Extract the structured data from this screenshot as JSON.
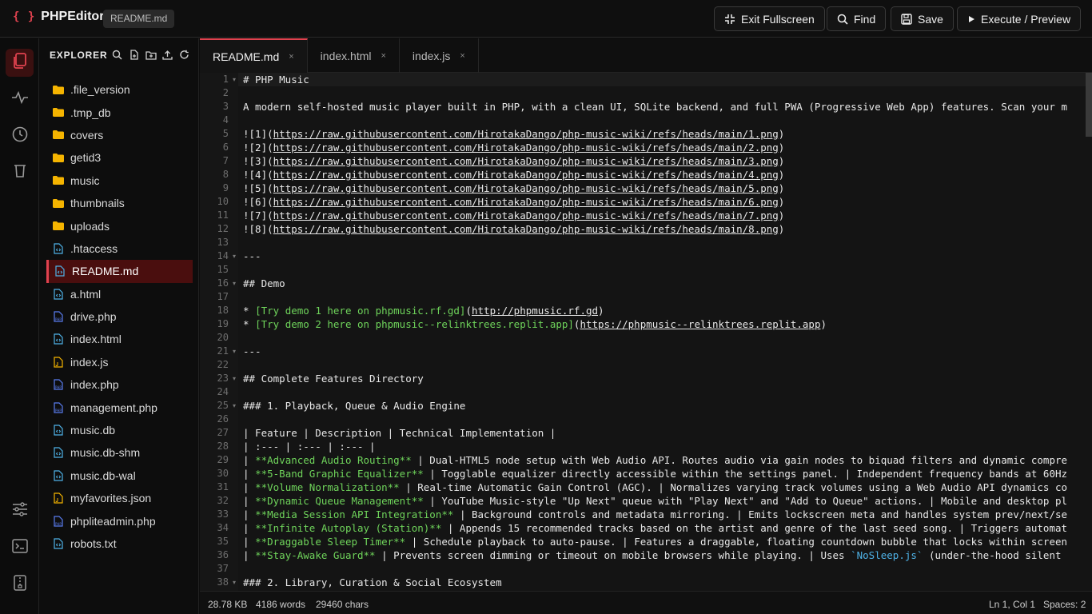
{
  "app": {
    "brand_icon": "{ }",
    "name": "PHPEditor",
    "file_badge": "README.md",
    "accent": "#e0424f"
  },
  "toolbar": {
    "exit_fullscreen": "Exit Fullscreen",
    "find": "Find",
    "save": "Save",
    "execute": "Execute / Preview"
  },
  "explorer": {
    "title": "EXPLORER",
    "items": [
      {
        "label": ".file_version",
        "type": "folder"
      },
      {
        "label": ".tmp_db",
        "type": "folder"
      },
      {
        "label": "covers",
        "type": "folder"
      },
      {
        "label": "getid3",
        "type": "folder"
      },
      {
        "label": "music",
        "type": "folder"
      },
      {
        "label": "thumbnails",
        "type": "folder"
      },
      {
        "label": "uploads",
        "type": "folder"
      },
      {
        "label": ".htaccess",
        "type": "file"
      },
      {
        "label": "README.md",
        "type": "file"
      },
      {
        "label": "a.html",
        "type": "file"
      },
      {
        "label": "drive.php",
        "type": "php"
      },
      {
        "label": "index.html",
        "type": "file"
      },
      {
        "label": "index.js",
        "type": "js"
      },
      {
        "label": "index.php",
        "type": "php"
      },
      {
        "label": "management.php",
        "type": "php"
      },
      {
        "label": "music.db",
        "type": "file"
      },
      {
        "label": "music.db-shm",
        "type": "file"
      },
      {
        "label": "music.db-wal",
        "type": "file"
      },
      {
        "label": "myfavorites.json",
        "type": "js"
      },
      {
        "label": "phpliteadmin.php",
        "type": "php"
      },
      {
        "label": "robots.txt",
        "type": "file"
      }
    ]
  },
  "tabs": [
    {
      "label": "README.md",
      "close": "×"
    },
    {
      "label": "index.html",
      "close": "×"
    },
    {
      "label": "index.js",
      "close": "×"
    }
  ],
  "editor": {
    "line_numbers": [
      "1",
      "2",
      "3",
      "4",
      "5",
      "6",
      "7",
      "8",
      "9",
      "10",
      "11",
      "12",
      "13",
      "14",
      "15",
      "16",
      "17",
      "18",
      "19",
      "20",
      "21",
      "22",
      "23",
      "24",
      "25",
      "26",
      "27",
      "28",
      "29",
      "30",
      "31",
      "32",
      "33",
      "34",
      "35",
      "36",
      "37",
      "38"
    ],
    "lines": {
      "l1": "# PHP Music",
      "l3": "A modern self-hosted music player built in PHP, with a clean UI, SQLite backend, and full PWA (Progressive Web App) features. Scan your m",
      "img_prefix": [
        "![1](",
        "![2](",
        "![3](",
        "![4](",
        "![5](",
        "![6](",
        "![7](",
        "![8]("
      ],
      "img_urls": [
        "https://raw.githubusercontent.com/HirotakaDango/php-music-wiki/refs/heads/main/1.png",
        "https://raw.githubusercontent.com/HirotakaDango/php-music-wiki/refs/heads/main/2.png",
        "https://raw.githubusercontent.com/HirotakaDango/php-music-wiki/refs/heads/main/3.png",
        "https://raw.githubusercontent.com/HirotakaDango/php-music-wiki/refs/heads/main/4.png",
        "https://raw.githubusercontent.com/HirotakaDango/php-music-wiki/refs/heads/main/5.png",
        "https://raw.githubusercontent.com/HirotakaDango/php-music-wiki/refs/heads/main/6.png",
        "https://raw.githubusercontent.com/HirotakaDango/php-music-wiki/refs/heads/main/7.png",
        "https://raw.githubusercontent.com/HirotakaDango/php-music-wiki/refs/heads/main/8.png"
      ],
      "close_paren": ")",
      "hr": "---",
      "l16": "## Demo",
      "l18_a": "* ",
      "l18_b": "[Try demo 1 here on phpmusic.rf.gd]",
      "l18_c": "(",
      "l18_d": "http://phpmusic.rf.gd",
      "l19_b": "[Try demo 2 here on phpmusic--relinktrees.replit.app]",
      "l19_d": "https://phpmusic--relinktrees.replit.app",
      "l23": "## Complete Features Directory",
      "l25": "### 1. Playback, Queue & Audio Engine",
      "l27": "| Feature | Description | Technical Implementation |",
      "l28": "| :--- | :--- | :--- |",
      "pipe": "| ",
      "l29_a": "**Advanced Audio Routing**",
      "l29_b": " | Dual-HTML5 node setup with Web Audio API. Routes audio via gain nodes to biquad filters and dynamic compre",
      "l30_a": "**5-Band Graphic Equalizer**",
      "l30_b": " | Togglable equalizer directly accessible within the settings panel. | Independent frequency bands at 60Hz",
      "l31_a": "**Volume Normalization**",
      "l31_b": " | Real-time Automatic Gain Control (AGC). | Normalizes varying track volumes using a Web Audio API dynamics co",
      "l32_a": "**Dynamic Queue Management**",
      "l32_b": " | YouTube Music-style \"Up Next\" queue with \"Play Next\" and \"Add to Queue\" actions. | Mobile and desktop pl",
      "l33_a": "**Media Session API Integration**",
      "l33_b": " | Background controls and metadata mirroring. | Emits lockscreen meta and handles system prev/next/se",
      "l34_a": "**Infinite Autoplay (Station)**",
      "l34_b": " | Appends 15 recommended tracks based on the artist and genre of the last seed song. | Triggers automat",
      "l35_a": "**Draggable Sleep Timer**",
      "l35_b": " | Schedule playback to auto-pause. | Features a draggable, floating countdown bubble that locks within screen",
      "l36_a": "**Stay-Awake Guard**",
      "l36_b": " | Prevents screen dimming or timeout on mobile browsers while playing. | Uses ",
      "l36_c": "`NoSleep.js`",
      "l36_d": " (under-the-hood silent",
      "l38": "### 2. Library, Curation & Social Ecosystem"
    }
  },
  "status": {
    "size": "28.78 KB",
    "words": "4186 words",
    "chars": "29460 chars",
    "cursor": "Ln 1, Col 1",
    "spaces": "Spaces: 2"
  }
}
